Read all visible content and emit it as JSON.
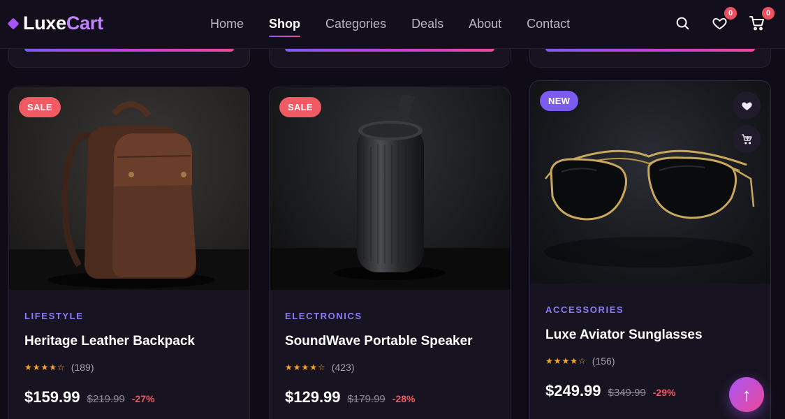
{
  "brand": {
    "part1": "Luxe",
    "part2": "Cart"
  },
  "nav": [
    {
      "label": "Home"
    },
    {
      "label": "Shop"
    },
    {
      "label": "Categories"
    },
    {
      "label": "Deals"
    },
    {
      "label": "About"
    },
    {
      "label": "Contact"
    }
  ],
  "header": {
    "wishlist_count": "0",
    "cart_count": "0"
  },
  "products": [
    {
      "tag": "SALE",
      "category": "LIFESTYLE",
      "title": "Heritage Leather Backpack",
      "stars": "★★★★☆",
      "rating_count": "(189)",
      "price": "$159.99",
      "old_price": "$219.99",
      "discount": "-27%"
    },
    {
      "tag": "SALE",
      "category": "ELECTRONICS",
      "title": "SoundWave Portable Speaker",
      "stars": "★★★★☆",
      "rating_count": "(423)",
      "price": "$129.99",
      "old_price": "$179.99",
      "discount": "-28%"
    },
    {
      "tag": "NEW",
      "category": "ACCESSORIES",
      "title": "Luxe Aviator Sunglasses",
      "stars": "★★★★☆",
      "rating_count": "(156)",
      "price": "$249.99",
      "old_price": "$349.99",
      "discount": "-29%"
    }
  ],
  "colors": {
    "accent": "#8b5cf6",
    "pink": "#ec4899",
    "sale": "#f05a63",
    "star": "#f5a623"
  }
}
